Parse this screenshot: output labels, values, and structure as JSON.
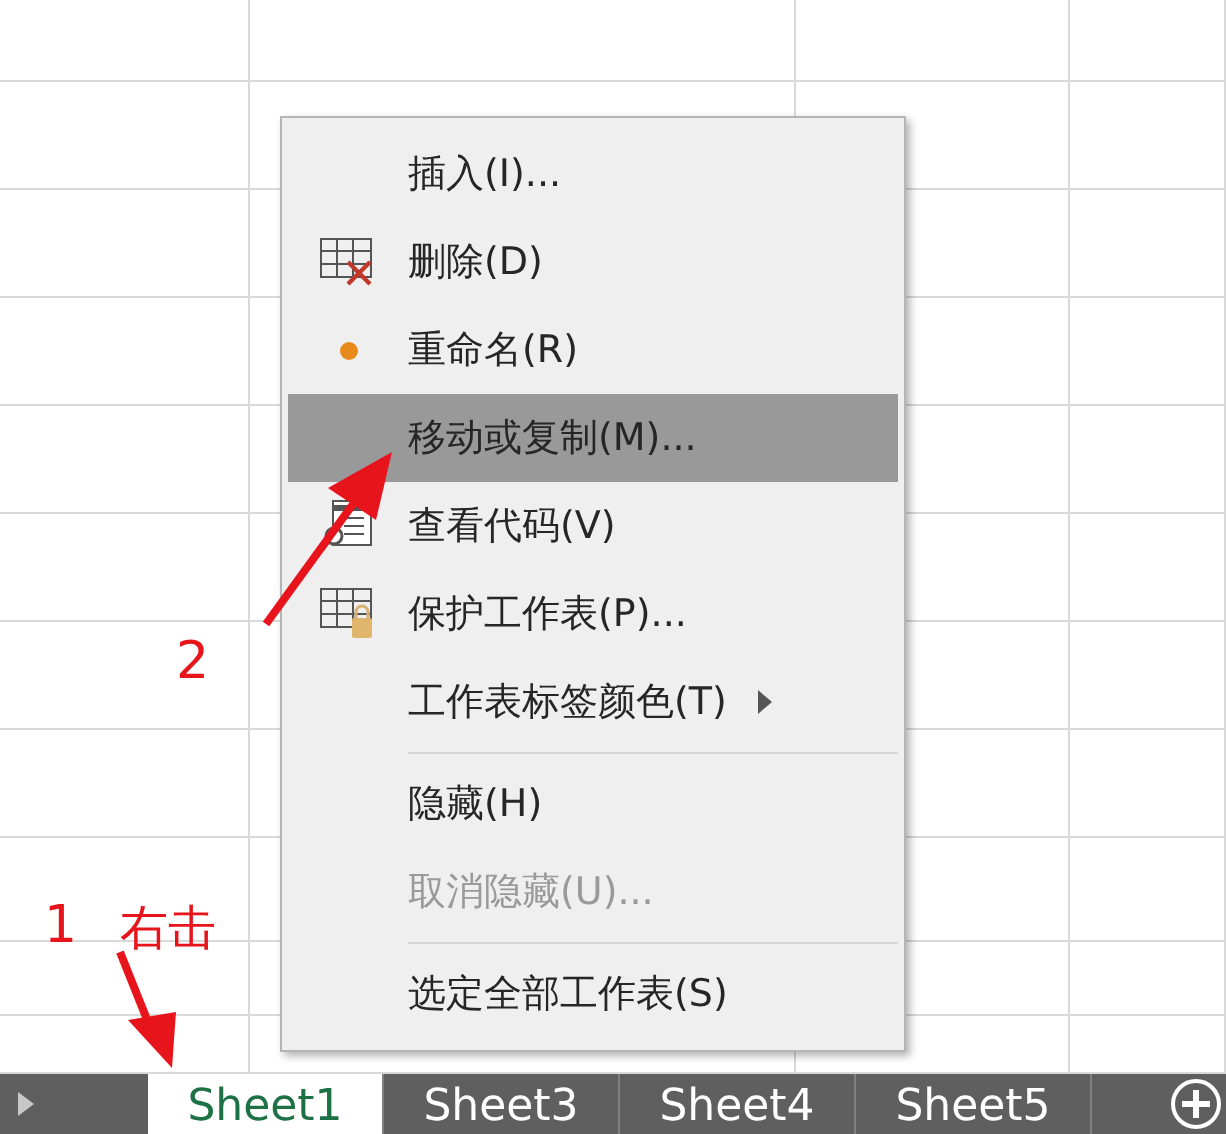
{
  "context_menu": {
    "items": [
      {
        "kind": "item",
        "label": "插入(I)...",
        "selected": false,
        "disabled": false,
        "submenu": false
      },
      {
        "kind": "item",
        "label": "删除(D)",
        "selected": false,
        "disabled": false,
        "submenu": false
      },
      {
        "kind": "item",
        "label": "重命名(R)",
        "selected": false,
        "disabled": false,
        "submenu": false
      },
      {
        "kind": "item",
        "label": "移动或复制(M)...",
        "selected": true,
        "disabled": false,
        "submenu": false
      },
      {
        "kind": "item",
        "label": "查看代码(V)",
        "selected": false,
        "disabled": false,
        "submenu": false
      },
      {
        "kind": "item",
        "label": "保护工作表(P)...",
        "selected": false,
        "disabled": false,
        "submenu": false
      },
      {
        "kind": "item",
        "label": "工作表标签颜色(T)",
        "selected": false,
        "disabled": false,
        "submenu": true
      },
      {
        "kind": "separator"
      },
      {
        "kind": "item",
        "label": "隐藏(H)",
        "selected": false,
        "disabled": false,
        "submenu": false
      },
      {
        "kind": "item",
        "label": "取消隐藏(U)...",
        "selected": false,
        "disabled": true,
        "submenu": false
      },
      {
        "kind": "separator"
      },
      {
        "kind": "item",
        "label": "选定全部工作表(S)",
        "selected": false,
        "disabled": false,
        "submenu": false
      }
    ]
  },
  "sheet_tabs": [
    {
      "label": "Sheet1",
      "selected": true
    },
    {
      "label": "Sheet3",
      "selected": false
    },
    {
      "label": "Sheet4",
      "selected": false
    },
    {
      "label": "Sheet5",
      "selected": false
    }
  ],
  "annotations": [
    {
      "number": "2"
    },
    {
      "number": "1",
      "text": "右击"
    }
  ]
}
